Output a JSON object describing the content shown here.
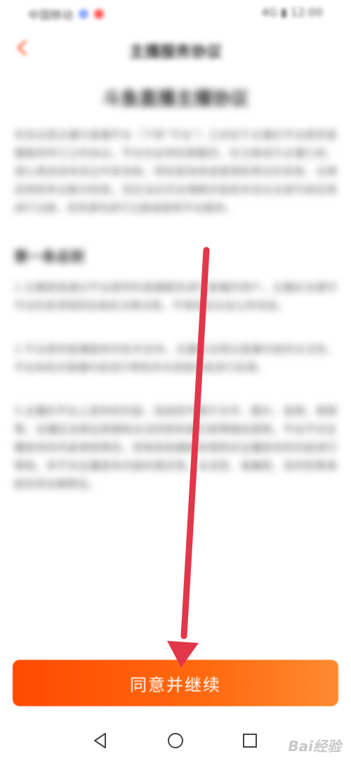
{
  "status_bar": {
    "left_text": "中国移动",
    "right_text": "4G  ▮ 12:00"
  },
  "header": {
    "title": "主播服务协议",
    "back_icon": "chevron-left-icon"
  },
  "document": {
    "title": "斗鱼直播主播协议",
    "intro": "本协议是主播与直播平台（下称“平台”）之间关于主播在平台提供直播服务所订立的协议。平台在此特别提醒您，在注册成为主播之前，请认真阅读本协议中各条款，特别是免除或者限制责任的条款、法律适用和争议解决条款。您应当在完全理解并接受本协议全部内容后再进行注册，否则请勿进行注册或使用平台服务。",
    "section_heading": "第一条总则",
    "para1": "1.主播是指通过平台提供的直播服务进行直播的用户，主播应当遵守平台的各项规则及相关法律法规，不得违反社会公序良俗。",
    "para2": "2.平台提供直播服务的技术支持，主播应当保证直播内容的合法性，平台有权对直播内容进行审核并对违规内容进行处理。",
    "para3": "3.主播在平台上发布的内容，包括但不限于文字、图片、音频、视频等，主播应当保证其拥有合法的权利或已获得相应授权。平台不对主播发布的内容承担责任，但有权依据相关规则对主播发布的内容进行审核，并不对主播发布内容的真实性、合法性、准确性、及时性等承担任何法律责任。"
  },
  "agree_button": {
    "label": "同意并继续"
  },
  "nav_bar": {
    "back_icon": "triangle-back-icon",
    "home_icon": "circle-home-icon",
    "recent_icon": "square-recent-icon"
  },
  "watermark": {
    "text": "Bai经验"
  },
  "colors": {
    "accent": "#ff5500",
    "arrow": "#e2364a",
    "button_start": "#ff4a00",
    "button_end": "#ff8a30"
  }
}
